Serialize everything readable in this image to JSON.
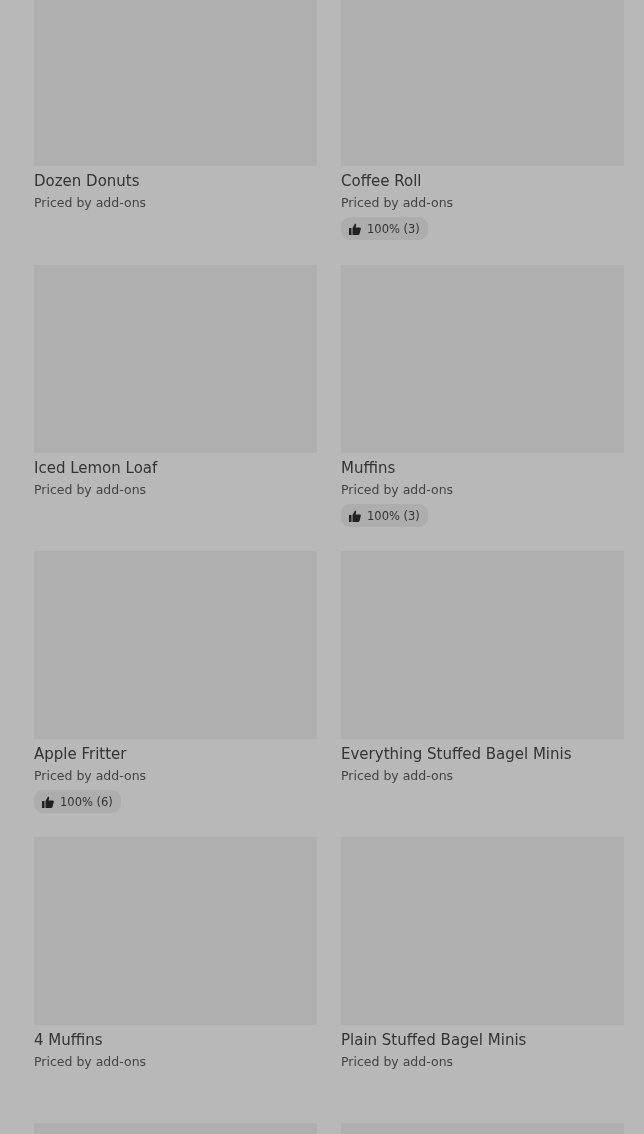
{
  "items": [
    {
      "kind": "product",
      "name": "Dozen Donuts",
      "price": "Priced by add-ons"
    },
    {
      "kind": "product",
      "name": "Coffee Roll",
      "price": "Priced by add-ons",
      "rating": "100% (3)"
    },
    {
      "kind": "product",
      "name": "Iced Lemon Loaf",
      "price": "Priced by add-ons"
    },
    {
      "kind": "product",
      "name": "Muffins",
      "price": "Priced by add-ons",
      "rating": "100% (3)"
    },
    {
      "kind": "product",
      "name": "Apple Fritter",
      "price": "Priced by add-ons",
      "rating": "100% (6)"
    },
    {
      "kind": "product",
      "name": "Everything Stuffed Bagel Minis",
      "price": "Priced by add-ons"
    },
    {
      "kind": "product",
      "name": "4 Muffins",
      "price": "Priced by add-ons"
    },
    {
      "kind": "product",
      "name": "Plain Stuffed Bagel Minis",
      "price": "Priced by add-ons"
    },
    {
      "kind": "picture"
    },
    {
      "kind": "picture"
    }
  ]
}
